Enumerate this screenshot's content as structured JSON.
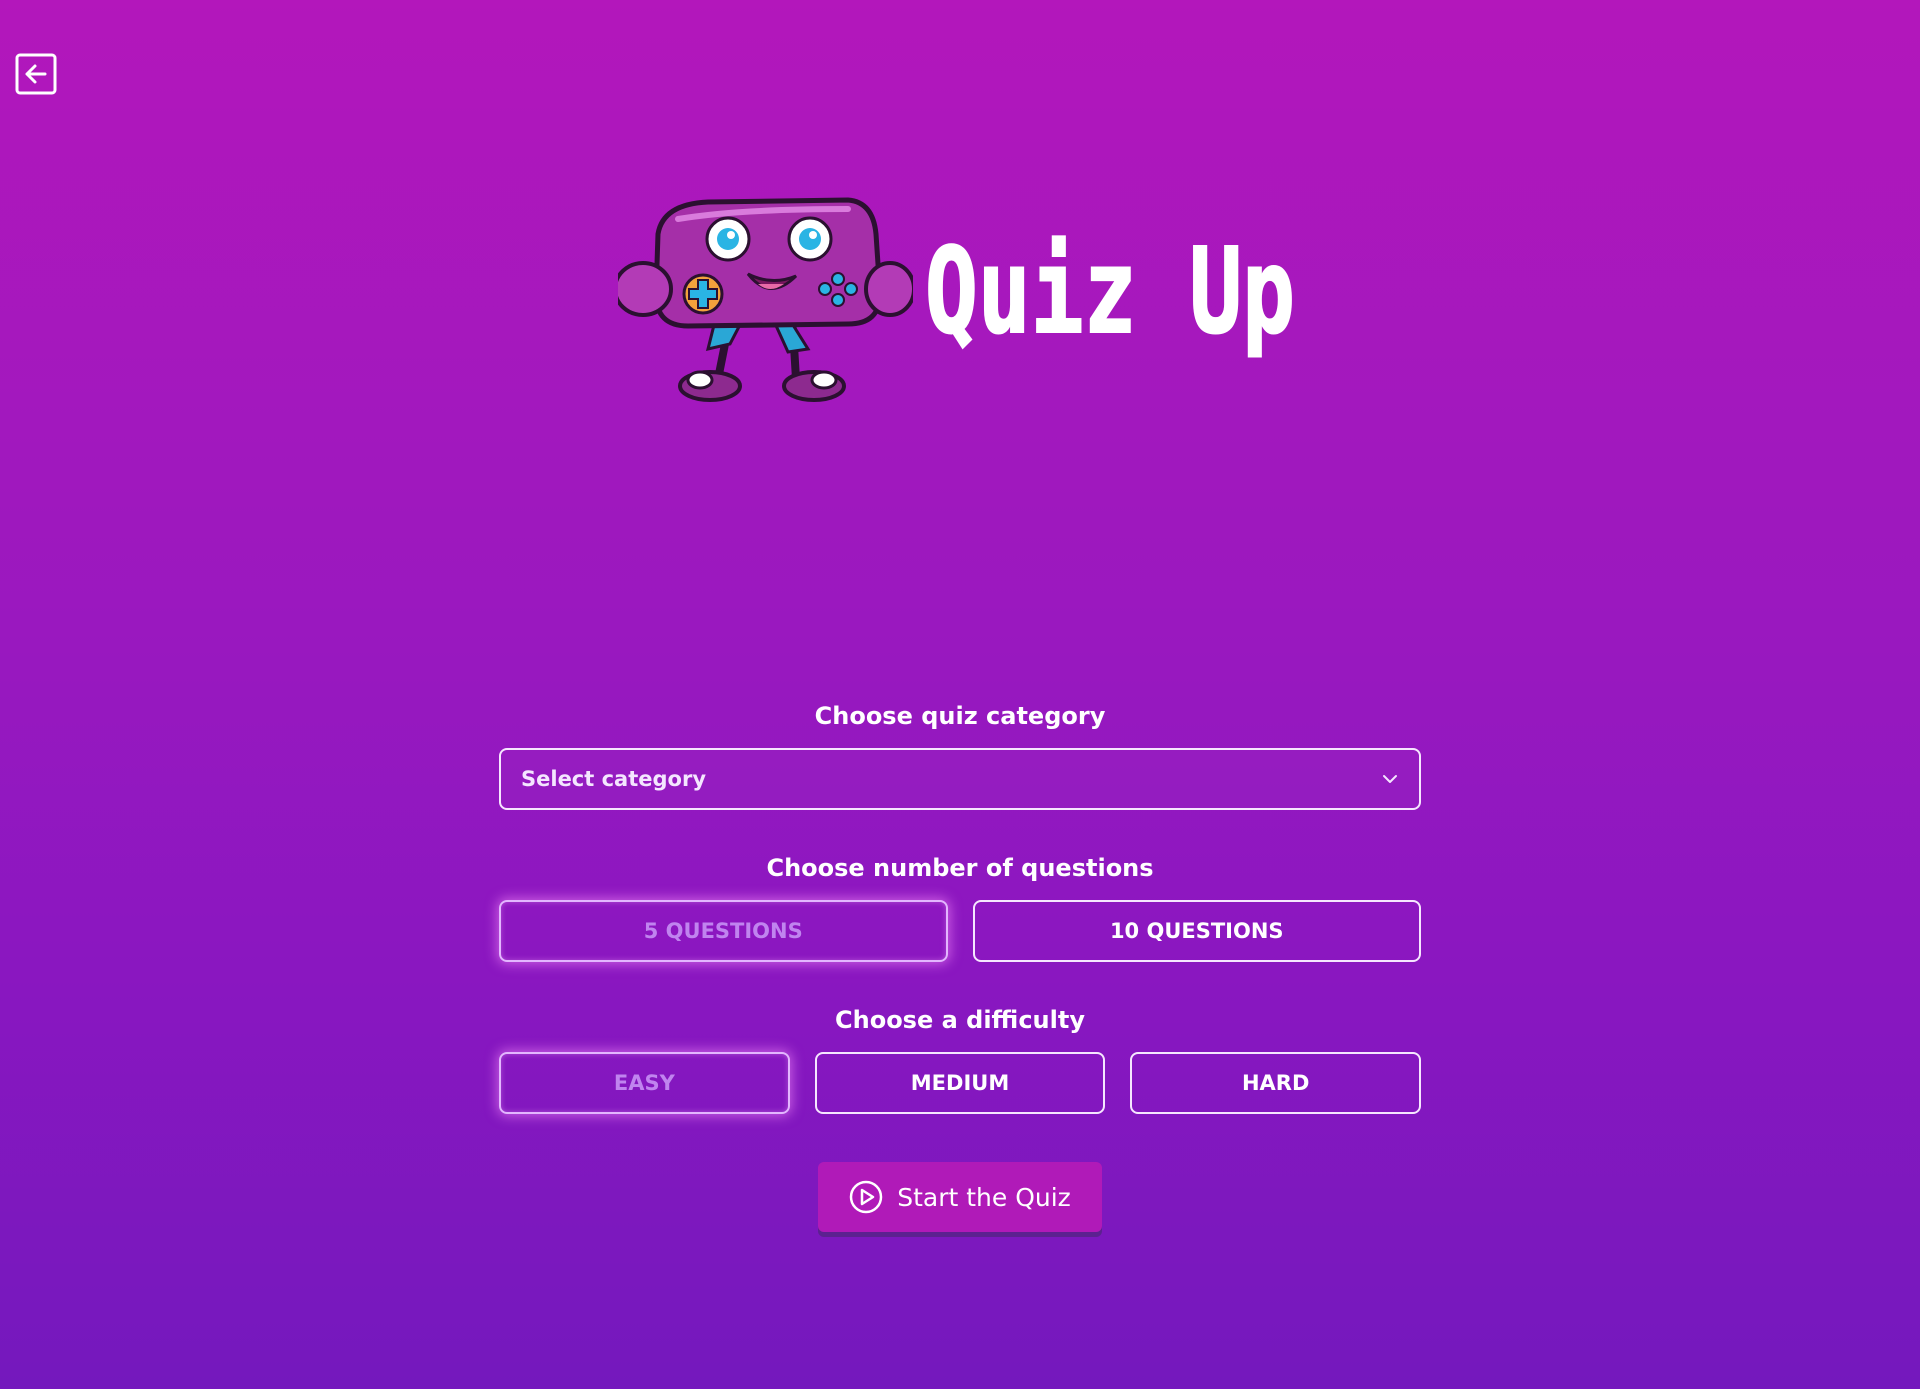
{
  "nav": {
    "back_icon": "arrow-left-square-icon"
  },
  "logo": {
    "title": "Quiz Up",
    "mascot_icon": "gamepad-mascot-icon"
  },
  "category": {
    "title": "Choose quiz category",
    "select_value": "Select category",
    "icon": "chevron-down-icon"
  },
  "questions": {
    "title": "Choose number of questions",
    "options": [
      {
        "label": "5 QUESTIONS",
        "selected": true
      },
      {
        "label": "10 QUESTIONS",
        "selected": false
      }
    ]
  },
  "difficulty": {
    "title": "Choose a difficulty",
    "options": [
      {
        "label": "EASY",
        "selected": true
      },
      {
        "label": "MEDIUM",
        "selected": false
      },
      {
        "label": "HARD",
        "selected": false
      }
    ]
  },
  "start": {
    "label": "Start the Quiz",
    "icon": "play-circle-icon"
  },
  "colors": {
    "background_top": "#b317bb",
    "background_bottom": "#7418bd",
    "button": "#b01ab8",
    "selected_text": "#c084ef"
  }
}
